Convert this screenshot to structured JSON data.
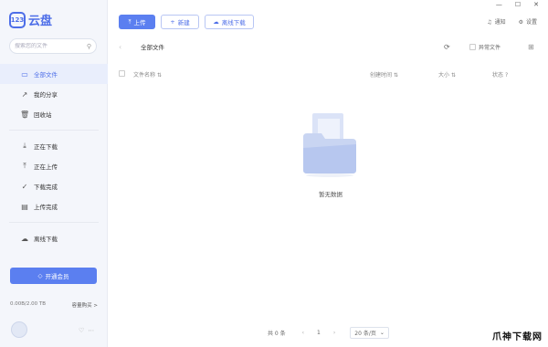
{
  "app": {
    "logo_badge": "123",
    "logo_text": "云盘"
  },
  "search": {
    "placeholder": "搜索您的文件"
  },
  "sidebar": {
    "items": [
      {
        "label": "全部文件",
        "icon": "folder-icon"
      },
      {
        "label": "我的分享",
        "icon": "share-icon"
      },
      {
        "label": "回收站",
        "icon": "trash-icon"
      },
      {
        "label": "正在下载",
        "icon": "download-icon"
      },
      {
        "label": "正在上传",
        "icon": "upload-icon"
      },
      {
        "label": "下载完成",
        "icon": "check-circle-icon"
      },
      {
        "label": "上传完成",
        "icon": "file-check-icon"
      },
      {
        "label": "离线下载",
        "icon": "cloud-download-icon"
      }
    ],
    "vip_label": "开通会员",
    "storage": "0.00B/2.00 TB",
    "buy_label": "容量购买 >"
  },
  "toolbar": {
    "upload": "上传",
    "new": "新建",
    "offline": "离线下载"
  },
  "top_right": {
    "notify": "通知",
    "settings": "设置"
  },
  "breadcrumb": {
    "current": "全部文件"
  },
  "filters": {
    "anomaly": "异常文件"
  },
  "table": {
    "col_name": "文件名称",
    "col_created": "创建时间",
    "col_size": "大小",
    "col_status": "状态"
  },
  "empty": {
    "text": "暂无数据"
  },
  "pagination": {
    "total": "共 0 条",
    "page": "1",
    "page_size": "20 条/页"
  },
  "watermark": "爪神下载网",
  "colors": {
    "accent": "#5b7ff0",
    "sidebar_bg": "#f4f6fb"
  }
}
